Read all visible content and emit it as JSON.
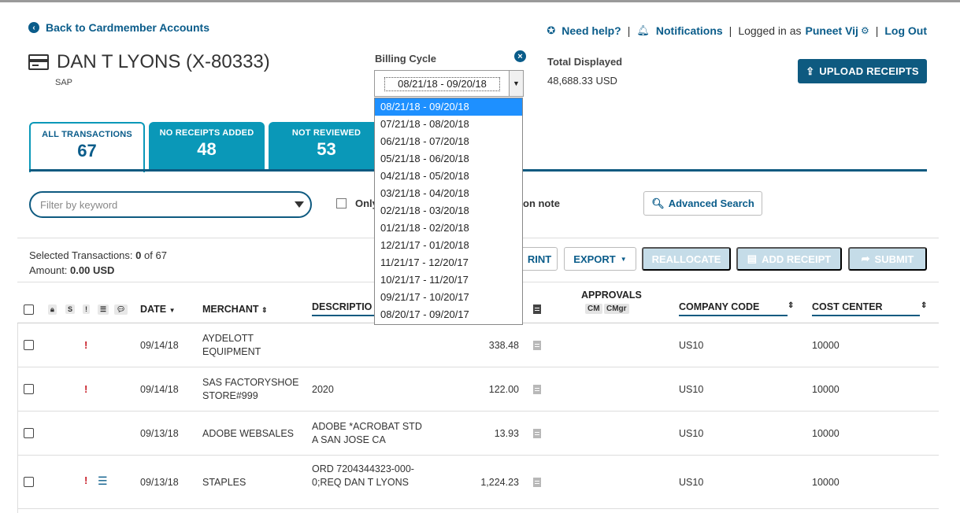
{
  "header": {
    "back_link": "Back to Cardmember Accounts",
    "cardholder_name": "DAN T LYONS (X-80333)",
    "company": "SAP",
    "billing_cycle_label": "Billing Cycle",
    "billing_cycle_value": "08/21/18 - 09/20/18",
    "total_label": "Total Displayed",
    "total_value": "48,688.33 USD",
    "need_help": "Need help?",
    "notifications": "Notifications",
    "logged_in_as": "Logged in as",
    "user_name": "Puneet Vij",
    "logout": "Log Out",
    "upload_receipts": "UPLOAD RECEIPTS"
  },
  "tabs": [
    {
      "label": "ALL TRANSACTIONS",
      "count": "67"
    },
    {
      "label": "NO RECEIPTS ADDED",
      "count": "48"
    },
    {
      "label": "NOT REVIEWED",
      "count": "53"
    }
  ],
  "filter": {
    "placeholder": "Filter by keyword",
    "only_label": "Only",
    "note_label": "on note",
    "advanced_search": "Advanced Search"
  },
  "selection": {
    "selected_label": "Selected Transactions:",
    "selected_count": "0",
    "of_label": "of 67",
    "amount_label": "Amount:",
    "amount_value": "0.00 USD"
  },
  "actions": {
    "print": "RINT",
    "export": "EXPORT",
    "reallocate": "REALLOCATE",
    "add_receipt": "ADD RECEIPT",
    "submit": "SUBMIT"
  },
  "table": {
    "headers": {
      "s": "S",
      "excl": "!",
      "date": "DATE",
      "merchant": "MERCHANT",
      "description": "DESCRIPTIO",
      "approvals": "APPROVALS",
      "cm": "CM",
      "cmgr": "CMgr",
      "company_code": "COMPANY CODE",
      "cost_center": "COST CENTER"
    },
    "rows": [
      {
        "date": "09/14/18",
        "merchant": "AYDELOTT EQUIPMENT",
        "description": "",
        "amount": "338.48",
        "company_code": "US10",
        "cost_center": "10000",
        "flag": "!",
        "list": ""
      },
      {
        "date": "09/14/18",
        "merchant": "SAS FACTORYSHOE STORE#999",
        "description": "2020",
        "amount": "122.00",
        "company_code": "US10",
        "cost_center": "10000",
        "flag": "!",
        "list": ""
      },
      {
        "date": "09/13/18",
        "merchant": "ADOBE WEBSALES",
        "description": "ADOBE *ACROBAT STD A SAN JOSE CA",
        "amount": "13.93",
        "company_code": "US10",
        "cost_center": "10000",
        "flag": "",
        "list": ""
      },
      {
        "date": "09/13/18",
        "merchant": "STAPLES",
        "description": "ORD 7204344323-000-0;REQ DAN T LYONS",
        "amount": "1,224.23",
        "company_code": "US10",
        "cost_center": "10000",
        "flag": "!",
        "list": "☰"
      }
    ]
  },
  "billing_cycles": [
    "08/21/18 - 09/20/18",
    "07/21/18 - 08/20/18",
    "06/21/18 - 07/20/18",
    "05/21/18 - 06/20/18",
    "04/21/18 - 05/20/18",
    "03/21/18 - 04/20/18",
    "02/21/18 - 03/20/18",
    "01/21/18 - 02/20/18",
    "12/21/17 - 01/20/18",
    "11/21/17 - 12/20/17",
    "10/21/17 - 11/20/17",
    "09/21/17 - 10/20/17",
    "08/20/17 - 09/20/17"
  ],
  "colors": {
    "brand_dark": "#0e5a80",
    "tab_teal": "#0a98b8",
    "flag_red": "#c81e28",
    "disabled_btn": "#c5dce8",
    "dropdown_selected": "#1e90ff"
  }
}
